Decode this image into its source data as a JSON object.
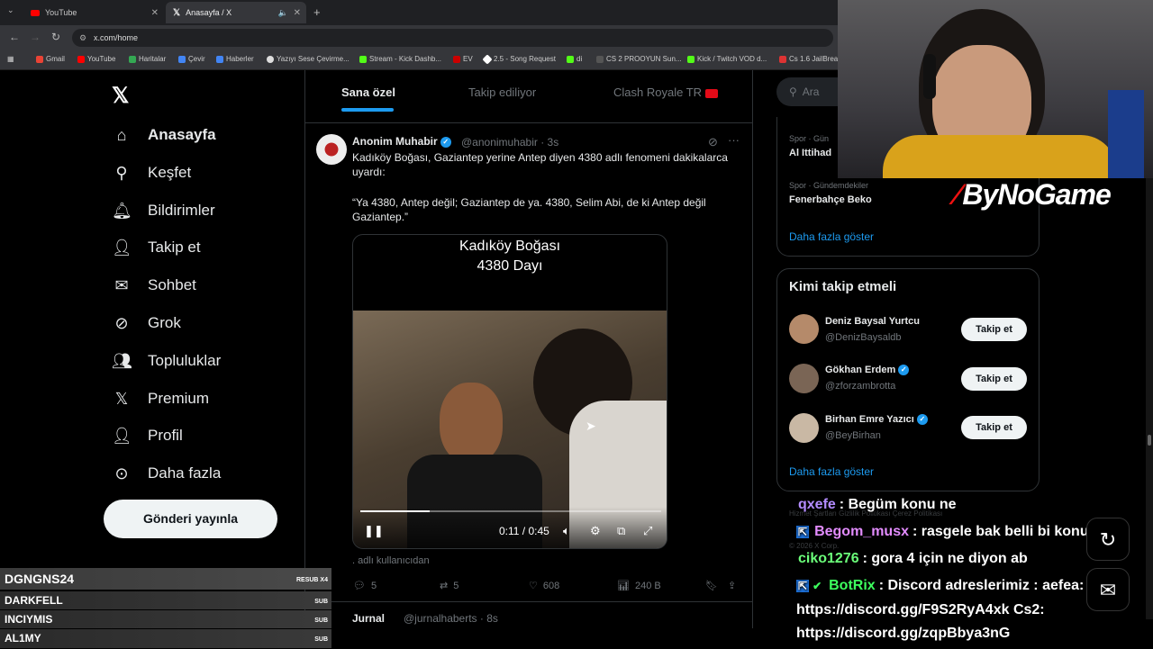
{
  "browser": {
    "tabs": [
      {
        "label": "YouTube",
        "color": "#ff0000"
      },
      {
        "label": "Anasayfa / X",
        "color": "#ffffff"
      }
    ],
    "url": "x.com/home",
    "bookmarks": [
      "Gmail",
      "YouTube",
      "Haritalar",
      "Çevir",
      "Haberler",
      "Yazıyı Sese Çevirme...",
      "Stream - Kick Dashb...",
      "EV",
      "2.5 - Song Request",
      "di",
      "CS 2 PROOYUN Sun...",
      "Kick / Twitch VOD d...",
      "Cs 1.6 JailBrea"
    ]
  },
  "nav": {
    "items": [
      "Anasayfa",
      "Keşfet",
      "Bildirimler",
      "Takip et",
      "Sohbet",
      "Grok",
      "Topluluklar",
      "Premium",
      "Profil",
      "Daha fazla"
    ],
    "post_button": "Gönderi yayınla"
  },
  "feed_tabs": [
    "Sana özel",
    "Takip ediliyor",
    "Clash Royale TR"
  ],
  "tweet": {
    "name": "Anonim Muhabir",
    "handle": "@anonimuhabir · 3s",
    "text1": "Kadıköy Boğası, Gaziantep yerine Antep diyen 4380 adlı fenomeni dakikalarca uyardı:",
    "text2": "“Ya 4380, Antep değil; Gaziantep de ya. 4380, Selim Abi, de ki Antep değil Gaziantep.”",
    "video_title_1": "Kadıköy Boğası",
    "video_title_2": "4380 Dayı",
    "video_time": "0:11 / 0:45",
    "video_progress": 0.23,
    "credit": ". adlı kullanıcıdan",
    "replies": "5",
    "reposts": "5",
    "likes": "608",
    "views": "240 B",
    "next_name": "Jurnal",
    "next_handle": "@jurnalhaberts · 8s"
  },
  "right": {
    "search_placeholder": "Ara",
    "trends": [
      {
        "sub": "Spor · Gün",
        "title": "Al Ittihad"
      },
      {
        "sub": "Spor · Gündemdekiler",
        "title": "Fenerbahçe Beko"
      }
    ],
    "show_more": "Daha fazla göster",
    "who_title": "Kimi takip etmeli",
    "who": [
      {
        "name": "Deniz Baysal Yurtcu",
        "handle": "@DenizBaysaldb",
        "verified": false
      },
      {
        "name": "Gökhan Erdem",
        "handle": "@zforzambrotta",
        "verified": true
      },
      {
        "name": "Birhan Emre Yazıcı",
        "handle": "@BeyBirhan",
        "verified": true
      }
    ],
    "follow_label": "Takip et",
    "show_more_2": "Daha fazla göster",
    "footer1": "Hizmet Şartları   Gizlilik Politikası   Çerez Politikası",
    "footer2": "© 2026 X Corp."
  },
  "stream": {
    "brand": "ByNoGame",
    "chat": [
      {
        "user": "qxefe",
        "color": "#b38cff",
        "msg": ": Begüm konu ne"
      },
      {
        "user": "Begom_musx",
        "color": "#e38cff",
        "msg": ": rasgele bak belli bi konu yok"
      },
      {
        "user": "ciko1276",
        "color": "#6bff7a",
        "msg": ": gora 4 için ne diyon ab"
      },
      {
        "user": "BotRix",
        "color": "#3dff5e",
        "msg": ": Discord adreslerimiz : aefea:"
      },
      {
        "user": "",
        "color": "#ffffff",
        "msg": "https://discord.gg/F9S2RyA4xk Cs2:"
      },
      {
        "user": "",
        "color": "#ffffff",
        "msg": "https://discord.gg/zqpBbya3nG"
      }
    ],
    "subs": [
      {
        "name": "DGNGNS24",
        "tag": "RESUB X4"
      },
      {
        "name": "DARKFELL",
        "tag": "SUB"
      },
      {
        "name": "INCIYMIS",
        "tag": "SUB"
      },
      {
        "name": "AL1MY",
        "tag": "SUB"
      }
    ]
  }
}
